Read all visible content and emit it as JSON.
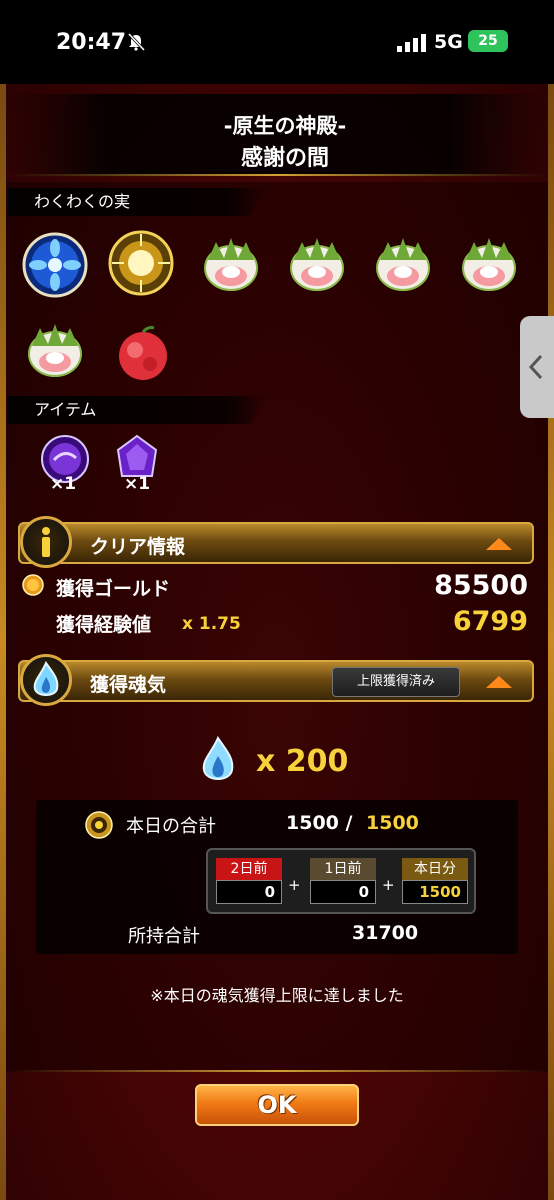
{
  "status_bar": {
    "time": "20:47",
    "network": "5G",
    "battery": "25"
  },
  "header": {
    "subtitle": "-原生の神殿-",
    "title": "感謝の間"
  },
  "fruits": {
    "label": "わくわくの実",
    "items": [
      {
        "icon": "blue-orb-fruit"
      },
      {
        "icon": "golden-burst-fruit"
      },
      {
        "icon": "lotus-fruit"
      },
      {
        "icon": "lotus-fruit"
      },
      {
        "icon": "lotus-fruit"
      },
      {
        "icon": "lotus-fruit"
      },
      {
        "icon": "lotus-fruit"
      },
      {
        "icon": "red-fruit"
      }
    ]
  },
  "items": {
    "label": "アイテム",
    "list": [
      {
        "icon": "purple-orb",
        "count": "×1"
      },
      {
        "icon": "purple-crystal",
        "count": "×1"
      }
    ]
  },
  "clear_info": {
    "title": "クリア情報",
    "gold_label": "獲得ゴールド",
    "gold_value": "85500",
    "exp_label": "獲得経験値",
    "exp_multiplier": "x 1.75",
    "exp_value": "6799"
  },
  "soul": {
    "title": "獲得魂気",
    "limit_badge": "上限獲得済み",
    "amount": "x 200",
    "today_total_label": "本日の合計",
    "today_total_value": "1500 /",
    "today_total_max": "1500",
    "breakdown": [
      {
        "label": "2日前",
        "value": "0",
        "color": "#c81414"
      },
      {
        "label": "1日前",
        "value": "0",
        "color": "#5a4a30"
      },
      {
        "label": "本日分",
        "value": "1500",
        "color": "#7a5a10"
      }
    ],
    "plus_sign": "+",
    "owned_label": "所持合計",
    "owned_value": "31700",
    "note": "※本日の魂気獲得上限に達しました"
  },
  "ok_button": "OK",
  "colors": {
    "accent_gold": "#f7d23a",
    "button_orange": "#f07a14",
    "panel_red": "#4a0404"
  }
}
